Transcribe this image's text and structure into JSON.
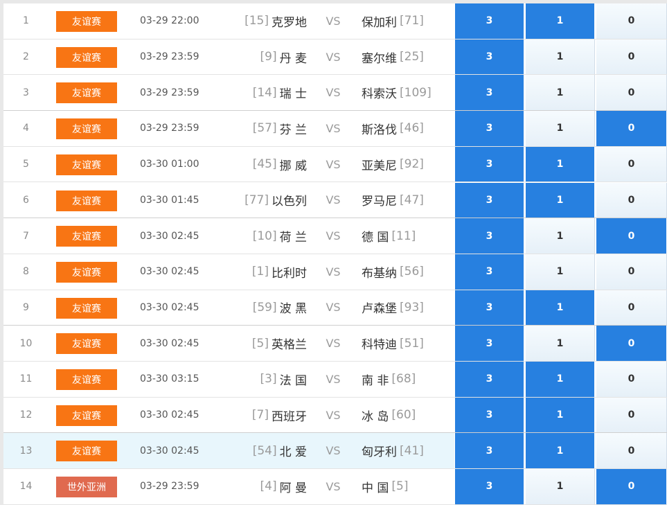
{
  "colors": {
    "league": "#f87514",
    "league_asia": "#e06a4f",
    "selected": "#2780e0",
    "highlight_row": "#e8f6fc"
  },
  "vs_label": "VS",
  "rows": [
    {
      "num": "1",
      "league": "友谊赛",
      "time": "03-29 22:00",
      "home_rank": "[15]",
      "home": "克罗地",
      "away": "保加利",
      "away_rank": "[71]",
      "odds": [
        "3",
        "1",
        "0"
      ],
      "selected": [
        0,
        1
      ]
    },
    {
      "num": "2",
      "league": "友谊赛",
      "time": "03-29 23:59",
      "home_rank": "[9]",
      "home": "丹 麦",
      "away": "塞尔维",
      "away_rank": "[25]",
      "odds": [
        "3",
        "1",
        "0"
      ],
      "selected": [
        0
      ]
    },
    {
      "num": "3",
      "league": "友谊赛",
      "time": "03-29 23:59",
      "home_rank": "[14]",
      "home": "瑞 士",
      "away": "科索沃",
      "away_rank": "[109]",
      "odds": [
        "3",
        "1",
        "0"
      ],
      "selected": [
        0
      ]
    },
    {
      "num": "4",
      "league": "友谊赛",
      "time": "03-29 23:59",
      "home_rank": "[57]",
      "home": "芬 兰",
      "away": "斯洛伐",
      "away_rank": "[46]",
      "odds": [
        "3",
        "1",
        "0"
      ],
      "selected": [
        0,
        2
      ]
    },
    {
      "num": "5",
      "league": "友谊赛",
      "time": "03-30 01:00",
      "home_rank": "[45]",
      "home": "挪 威",
      "away": "亚美尼",
      "away_rank": "[92]",
      "odds": [
        "3",
        "1",
        "0"
      ],
      "selected": [
        0,
        1
      ]
    },
    {
      "num": "6",
      "league": "友谊赛",
      "time": "03-30 01:45",
      "home_rank": "[77]",
      "home": "以色列",
      "away": "罗马尼",
      "away_rank": "[47]",
      "odds": [
        "3",
        "1",
        "0"
      ],
      "selected": [
        0,
        1
      ]
    },
    {
      "num": "7",
      "league": "友谊赛",
      "time": "03-30 02:45",
      "home_rank": "[10]",
      "home": "荷 兰",
      "away": "德 国",
      "away_rank": "[11]",
      "odds": [
        "3",
        "1",
        "0"
      ],
      "selected": [
        0,
        2
      ]
    },
    {
      "num": "8",
      "league": "友谊赛",
      "time": "03-30 02:45",
      "home_rank": "[1]",
      "home": "比利时",
      "away": "布基纳",
      "away_rank": "[56]",
      "odds": [
        "3",
        "1",
        "0"
      ],
      "selected": [
        0
      ]
    },
    {
      "num": "9",
      "league": "友谊赛",
      "time": "03-30 02:45",
      "home_rank": "[59]",
      "home": "波 黑",
      "away": "卢森堡",
      "away_rank": "[93]",
      "odds": [
        "3",
        "1",
        "0"
      ],
      "selected": [
        0,
        1
      ]
    },
    {
      "num": "10",
      "league": "友谊赛",
      "time": "03-30 02:45",
      "home_rank": "[5]",
      "home": "英格兰",
      "away": "科特迪",
      "away_rank": "[51]",
      "odds": [
        "3",
        "1",
        "0"
      ],
      "selected": [
        0,
        2
      ]
    },
    {
      "num": "11",
      "league": "友谊赛",
      "time": "03-30 03:15",
      "home_rank": "[3]",
      "home": "法 国",
      "away": "南 非",
      "away_rank": "[68]",
      "odds": [
        "3",
        "1",
        "0"
      ],
      "selected": [
        0,
        1
      ]
    },
    {
      "num": "12",
      "league": "友谊赛",
      "time": "03-30 02:45",
      "home_rank": "[7]",
      "home": "西班牙",
      "away": "冰 岛",
      "away_rank": "[60]",
      "odds": [
        "3",
        "1",
        "0"
      ],
      "selected": [
        0,
        1
      ]
    },
    {
      "num": "13",
      "league": "友谊赛",
      "time": "03-30 02:45",
      "home_rank": "[54]",
      "home": "北 爱",
      "away": "匈牙利",
      "away_rank": "[41]",
      "odds": [
        "3",
        "1",
        "0"
      ],
      "selected": [
        0,
        1
      ],
      "highlight": true
    },
    {
      "num": "14",
      "league": "世外亚洲",
      "time": "03-29 23:59",
      "home_rank": "[4]",
      "home": "阿 曼",
      "away": "中 国",
      "away_rank": "[5]",
      "odds": [
        "3",
        "1",
        "0"
      ],
      "selected": [
        0,
        2
      ],
      "asia": true
    }
  ]
}
